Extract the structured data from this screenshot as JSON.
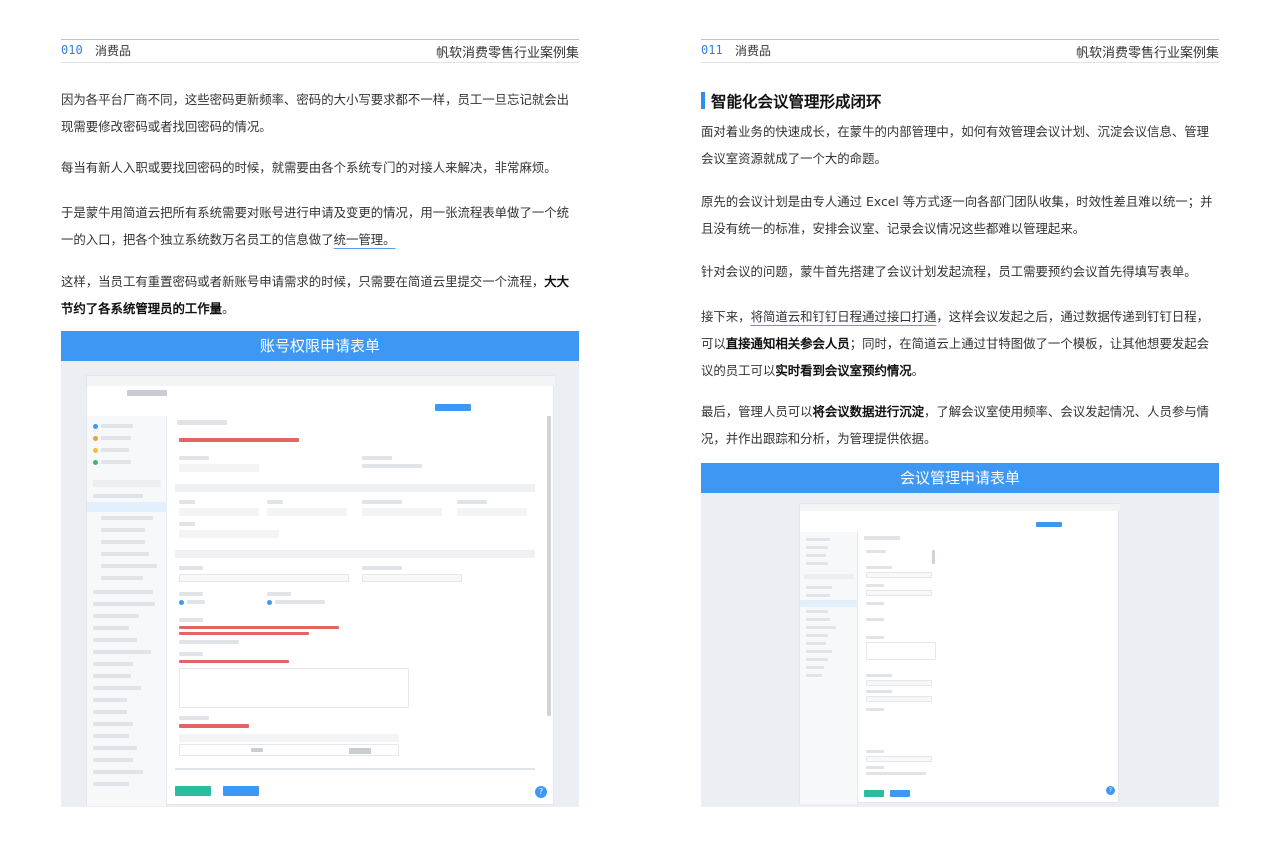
{
  "left": {
    "page_number": "010",
    "section": "消费品",
    "book_title": "帆软消费零售行业案例集",
    "p1": "因为各平台厂商不同，这些密码更新频率、密码的大小写要求都不一样，员工一旦忘记就会出现需要修改密码或者找回密码的情况。",
    "p2": "每当有新人入职或要找回密码的时候，就需要由各个系统专门的对接人来解决，非常麻烦。",
    "p3_a": "于是蒙牛用简道云把所有系统需要对账号进行申请及变更的情况，用一张流程表单做了一个统一的入口，把各个独立系统数万名员工的信息做了",
    "p3_link": "统一管理。",
    "p4_a": "这样，当员工有重置密码或者新账号申请需求的时候，只需要在简道云里提交一个流程，",
    "p4_bold": "大大节约了各系统管理员的工作量",
    "p4_end": "。",
    "banner": "账号权限申请表单"
  },
  "right": {
    "page_number": "011",
    "section": "消费品",
    "book_title": "帆软消费零售行业案例集",
    "heading": "智能化会议管理形成闭环",
    "p1": "面对着业务的快速成长，在蒙牛的内部管理中，如何有效管理会议计划、沉淀会议信息、管理会议室资源就成了一个大的命题。",
    "p2": "原先的会议计划是由专人通过 Excel 等方式逐一向各部门团队收集，时效性差且难以统一；并且没有统一的标准，安排会议室、记录会议情况这些都难以管理起来。",
    "p3": "针对会议的问题，蒙牛首先搭建了会议计划发起流程，员工需要预约会议首先得填写表单。",
    "p4_a": "接下来，",
    "p4_link": "将简道云和钉钉日程通过接口打通",
    "p4_b": "，这样会议发起之后，通过数据传递到钉钉日程，可以",
    "p4_bold1": "直接通知相关参会人员",
    "p4_c": "；同时，在简道云上通过甘特图做了一个模板，让其他想要发起会议的员工可以",
    "p4_bold2": "实时看到会议室预约情况",
    "p4_end": "。",
    "p5_a": "最后，管理人员可以",
    "p5_bold": "将会议数据进行沉淀",
    "p5_b": "，了解会议室使用频率、会议发起情况、人员参与情况，并作出跟踪和分析，为管理提供依据。",
    "banner": "会议管理申请表单"
  }
}
